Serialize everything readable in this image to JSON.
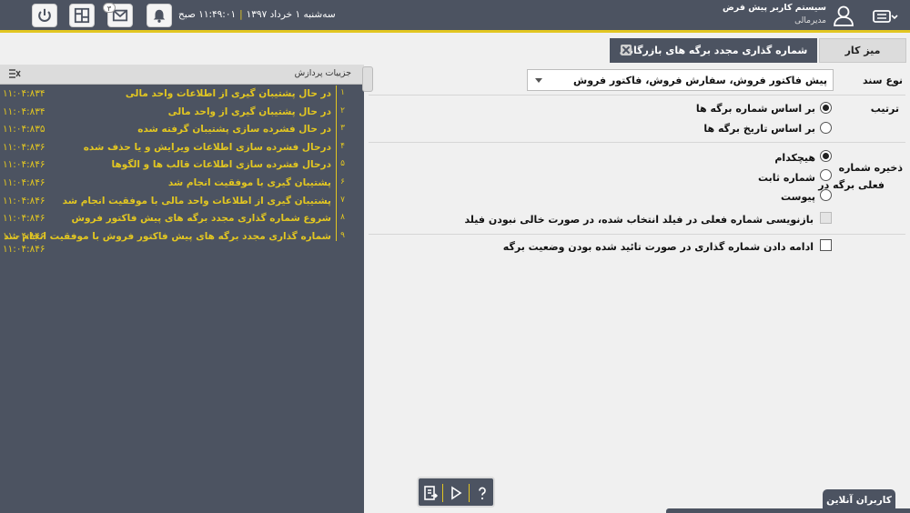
{
  "header": {
    "date_text": "سه‌شنبه ۱ خرداد ۱۳۹۷",
    "time_text": "۱۱:۴۹:۰۱ صبح",
    "messages_badge": "۳",
    "user_name": "سیستم کاربر پیش فرض",
    "user_role": "مدیرمالی",
    "accent_color": "#e2c621",
    "header_color": "#4c5361",
    "icons": [
      "menu-icon",
      "user-icon",
      "bell-icon",
      "mail-icon",
      "dashboard-icon",
      "power-icon"
    ]
  },
  "tabs": {
    "home_label": "میز کار",
    "active_label": "شماره گذاری مجدد برگه های بازرگانی"
  },
  "log_panel": {
    "title": "جزییات پردازش",
    "rows": [
      {
        "num": "۱",
        "message": "در حال پشتیبان گیری از اطلاعات واحد مالی",
        "ts": "۱۱:۰۴:۸۳۴"
      },
      {
        "num": "۲",
        "message": "در حال پشتیبان گیری از واحد مالی",
        "ts": "۱۱:۰۴:۸۳۴"
      },
      {
        "num": "۳",
        "message": "در حال فشرده سازی پشتیبان گرفته شده",
        "ts": "۱۱:۰۴:۸۳۵"
      },
      {
        "num": "۴",
        "message": "درحال فشرده سازی اطلاعات ویرایش و یا حذف شده",
        "ts": "۱۱:۰۴:۸۳۶"
      },
      {
        "num": "۵",
        "message": "درحال فشرده سازی اطلاعات قالب ها و الگوها",
        "ts": "۱۱:۰۴:۸۴۶"
      },
      {
        "num": "۶",
        "message": "پشتیبان گیری با موفقیت انجام شد",
        "ts": "۱۱:۰۴:۸۴۶"
      },
      {
        "num": "۷",
        "message": "پشتیبان گیری از اطلاعات واحد مالی با موفقیت انجام شد",
        "ts": "۱۱:۰۴:۸۴۶"
      },
      {
        "num": "۸",
        "message": "شروع شماره گذاری مجدد برگه های پیش فاکتور فروش",
        "ts": "۱۱:۰۴:۸۴۶"
      },
      {
        "num": "۹",
        "message": "شماره گذاری مجدد برگه های پیش فاکتور فروش با موفقیت انجام شد",
        "ts": "۱۱:۰۴:۸۴۶"
      }
    ],
    "final_ts": "۱۱:۰۴:۸۴۶"
  },
  "form": {
    "doc_type_label": "نوع سند",
    "doc_type_value": "پیش فاکتور فروش، سفارش فروش، فاکتور فروش",
    "order_label": "ترتیب",
    "order_options": [
      "بر اساس شماره برگه ها",
      "بر اساس تاریخ برگه ها"
    ],
    "order_selected": 0,
    "save_label_line1": "ذخیره شماره",
    "save_label_line2": "فعلی برگه در",
    "save_options": [
      "هیچکدام",
      "شماره ثابت",
      "پیوست"
    ],
    "save_selected": 0,
    "reset_checkbox_label": "بازنویسی شماره فعلی در فیلد انتخاب شده، در صورت خالی نبودن فیلد",
    "reset_checkbox_checked": false,
    "continue_checkbox_label": "ادامه دادن شماره گذاری در صورت تائید شده بودن وضعیت برگه",
    "continue_checkbox_checked": false
  },
  "footer": {
    "online_users_label": "کاربران آنلاین",
    "toolbar_icons": [
      "export-icon",
      "play-icon",
      "help-icon"
    ]
  }
}
